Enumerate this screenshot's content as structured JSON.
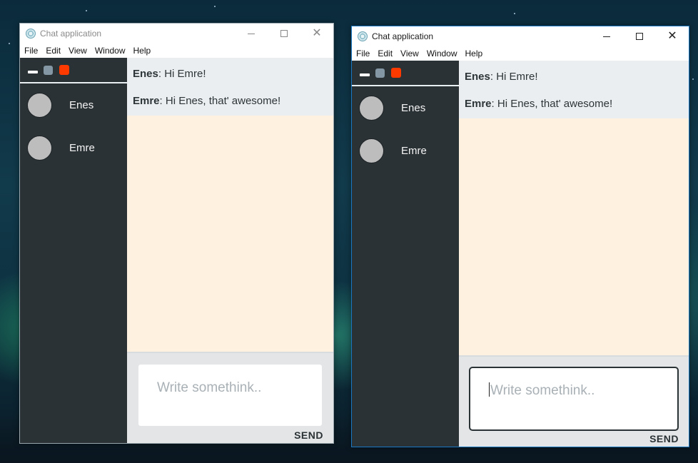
{
  "windows": [
    {
      "title": "Chat application",
      "menu": [
        "File",
        "Edit",
        "View",
        "Window",
        "Help"
      ],
      "contacts": [
        "Enes",
        "Emre"
      ],
      "messages": [
        {
          "sender": "Enes",
          "text": ": Hi Emre!"
        },
        {
          "sender": "Emre",
          "text": ": Hi Enes, that' awesome!"
        }
      ],
      "input_placeholder": "Write somethink..",
      "send_label": "SEND",
      "focused": false
    },
    {
      "title": "Chat application",
      "menu": [
        "File",
        "Edit",
        "View",
        "Window",
        "Help"
      ],
      "contacts": [
        "Enes",
        "Emre"
      ],
      "messages": [
        {
          "sender": "Enes",
          "text": ": Hi Emre!"
        },
        {
          "sender": "Emre",
          "text": ": Hi Enes, that' awesome!"
        }
      ],
      "input_placeholder": "Write somethink..",
      "send_label": "SEND",
      "focused": true
    }
  ],
  "colors": {
    "sidebar": "#2b3235",
    "chat_background": "#fff1df",
    "messages_background": "#eaeef0",
    "composer_background": "#e3e5e6",
    "accent_red": "#ff3a00",
    "accent_gray": "#8497a4",
    "avatar": "#bdbdbd"
  },
  "icons": [
    "app-icon",
    "minimize-icon",
    "maximize-icon",
    "close-icon"
  ]
}
